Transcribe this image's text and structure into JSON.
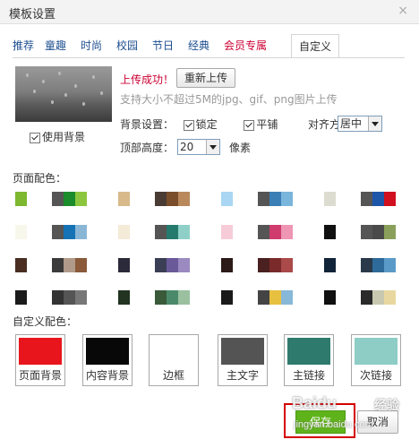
{
  "dialog": {
    "title": "模板设置",
    "close": "×"
  },
  "tabs": [
    "推荐",
    "童趣",
    "时尚",
    "校园",
    "节日",
    "经典",
    "会员专属",
    "自定义"
  ],
  "upload": {
    "use_bg_label": "使用背景",
    "success_text": "上传成功！",
    "reupload_label": "重新上传",
    "hint": "支持大小不超过5M的jpg、gif、png图片上传"
  },
  "settings": {
    "bg_label": "背景设置：",
    "lock_label": "锁定",
    "tile_label": "平铺",
    "align_label": "对齐方式：",
    "align_value": "居中",
    "height_label": "顶部高度：",
    "height_value": "20",
    "height_unit": "像素"
  },
  "palettes_title": "页面配色：",
  "palettes": [
    [
      "#7db82f",
      "#555555",
      "#1b8c2b",
      "#8cc63e"
    ],
    [
      "#d8b98a",
      "#4a3c34",
      "#7a4d2b",
      "#b9895c"
    ],
    [
      "#a9d6f2",
      "#555555",
      "#3a7fb5",
      "#7ab5dc"
    ],
    [
      "#dcdcd0",
      "#555555",
      "#1d55a8",
      "#d0101e"
    ],
    [
      "#f8f7ec",
      "#555555",
      "#1572b5",
      "#8ab6d6"
    ],
    [
      "#f3ebd7",
      "#555555",
      "#257a6e",
      "#8ed0c8"
    ],
    [
      "#f6ccd8",
      "#555555",
      "#d03b6d",
      "#ee96b3"
    ],
    [
      "#101010",
      "#555555",
      "#4a4a4a",
      "#8aa05a"
    ],
    [
      "#4a2e22",
      "#3b3b3b",
      "#b09a8a",
      "#8a5a3a"
    ],
    [
      "#2b2a3a",
      "#3b3f55",
      "#6a5a9a",
      "#9a8ac0"
    ],
    [
      "#2b1a18",
      "#4a2020",
      "#7a2a2a",
      "#aa4a4a"
    ],
    [
      "#12243a",
      "#2a3a4a",
      "#2e6a9a",
      "#5a9ac8"
    ],
    [
      "#1a1a1a",
      "#333333",
      "#555555",
      "#777777"
    ],
    [
      "#223322",
      "#3a5a3a",
      "#4a8a6a",
      "#9ac0a0"
    ],
    [
      "#1a1a1a",
      "#444444",
      "#e8c040",
      "#88b8d8"
    ],
    [
      "#101010",
      "#2a2a2a",
      "#c8c8b0",
      "#e8d8a0"
    ]
  ],
  "custom_title": "自定义配色：",
  "custom": [
    {
      "label": "页面背景",
      "color": "#e8161c"
    },
    {
      "label": "内容背景",
      "color": "#080808"
    },
    {
      "label": "边框",
      "color": "#ffffff"
    },
    {
      "label": "主文字",
      "color": "#545454"
    },
    {
      "label": "主链接",
      "color": "#2e7b6e"
    },
    {
      "label": "次链接",
      "color": "#8ecdc6"
    }
  ],
  "actions": {
    "save_label": "保存",
    "cancel_label": "取消"
  },
  "watermark": {
    "brand": "Baidu",
    "sub": "jingyan.baidu.com",
    "zh": "经验"
  }
}
